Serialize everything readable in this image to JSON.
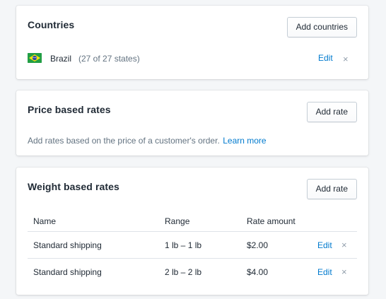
{
  "countries": {
    "title": "Countries",
    "add_button": "Add countries",
    "items": [
      {
        "flag_icon": "brazil-flag-icon",
        "name": "Brazil",
        "states": "(27 of 27 states)",
        "edit": "Edit",
        "remove": "×"
      }
    ]
  },
  "price_rates": {
    "title": "Price based rates",
    "add_button": "Add rate",
    "description": "Add rates based on the price of a customer's order.",
    "learn_more": "Learn more"
  },
  "weight_rates": {
    "title": "Weight based rates",
    "add_button": "Add rate",
    "columns": [
      "Name",
      "Range",
      "Rate amount"
    ],
    "rows": [
      {
        "name": "Standard shipping",
        "range": "1 lb – 1 lb",
        "amount": "$2.00",
        "edit": "Edit",
        "remove": "×"
      },
      {
        "name": "Standard shipping",
        "range": "2 lb – 2 lb",
        "amount": "$4.00",
        "edit": "Edit",
        "remove": "×"
      }
    ]
  },
  "colors": {
    "link": "#007ace",
    "background": "#f4f6f8",
    "card": "#ffffff",
    "border": "#c4cdd5"
  }
}
